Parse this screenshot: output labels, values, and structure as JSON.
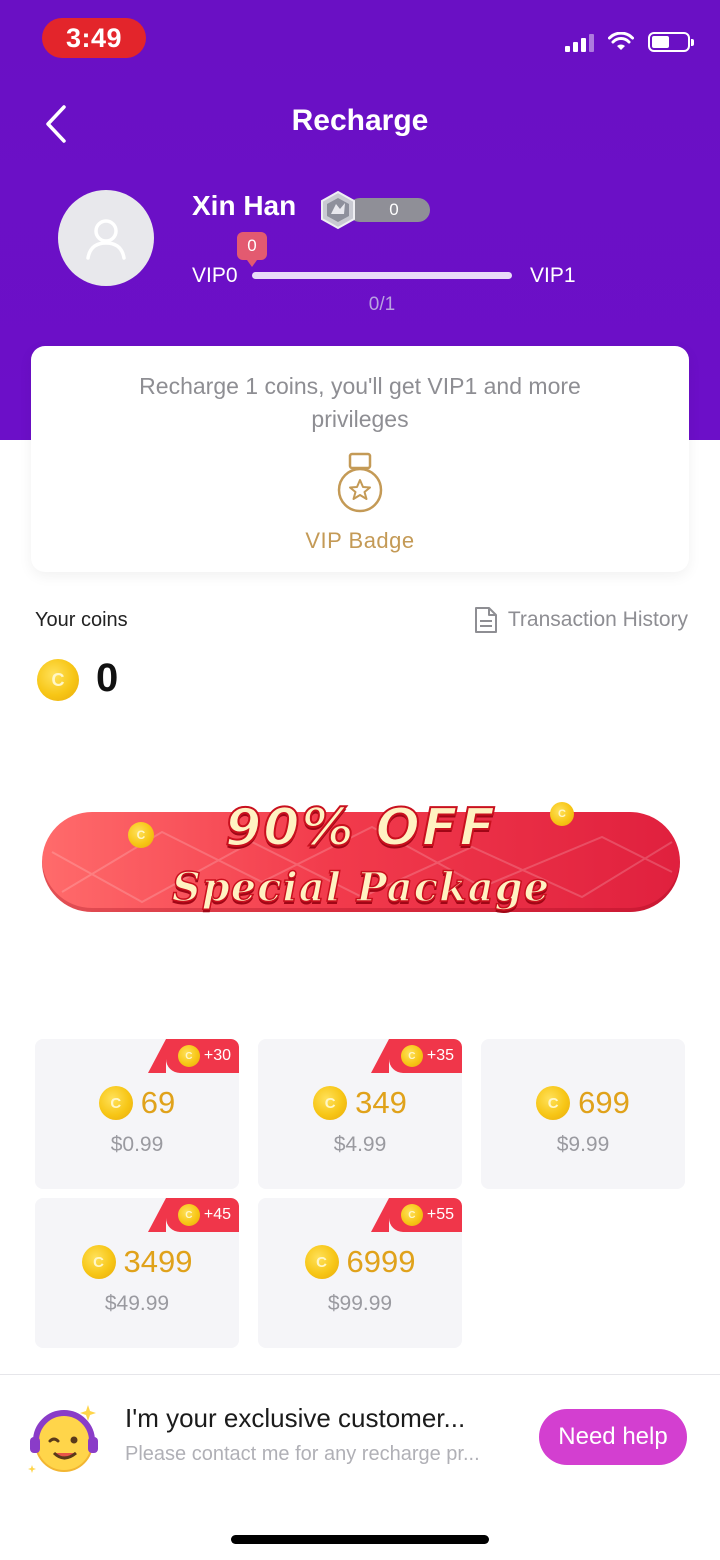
{
  "status_bar": {
    "time": "3:49"
  },
  "header": {
    "title": "Recharge"
  },
  "profile": {
    "name": "Xin Han",
    "level_count": "0",
    "vip_marker": "0",
    "vip_current": "VIP0",
    "vip_next": "VIP1",
    "vip_progress_text": "0/1",
    "vip_progress": 0
  },
  "vip_card": {
    "message": "Recharge 1 coins, you'll get VIP1 and more privileges",
    "badge_label": "VIP Badge"
  },
  "coins": {
    "label": "Your coins",
    "history_label": "Transaction History",
    "balance": "0"
  },
  "banner": {
    "line1": "90% OFF",
    "line2": "Special Package"
  },
  "packages": [
    {
      "coins": "69",
      "price": "$0.99",
      "bonus": "+30"
    },
    {
      "coins": "349",
      "price": "$4.99",
      "bonus": "+35"
    },
    {
      "coins": "699",
      "price": "$9.99",
      "bonus": ""
    },
    {
      "coins": "3499",
      "price": "$49.99",
      "bonus": "+45"
    },
    {
      "coins": "6999",
      "price": "$99.99",
      "bonus": "+55"
    }
  ],
  "help": {
    "title": "I'm your exclusive customer...",
    "subtitle": "Please contact me for any recharge pr...",
    "button": "Need help"
  },
  "colors": {
    "header_purple": "#6a10c4",
    "accent_gold": "#e0a21b",
    "bonus_red": "#f0364a",
    "help_button": "#d33fd0"
  },
  "icons": [
    "back-icon",
    "signal-icon",
    "wifi-icon",
    "battery-icon",
    "user-icon",
    "level-shield-icon",
    "medal-icon",
    "document-icon",
    "coin-icon",
    "support-agent-icon"
  ]
}
